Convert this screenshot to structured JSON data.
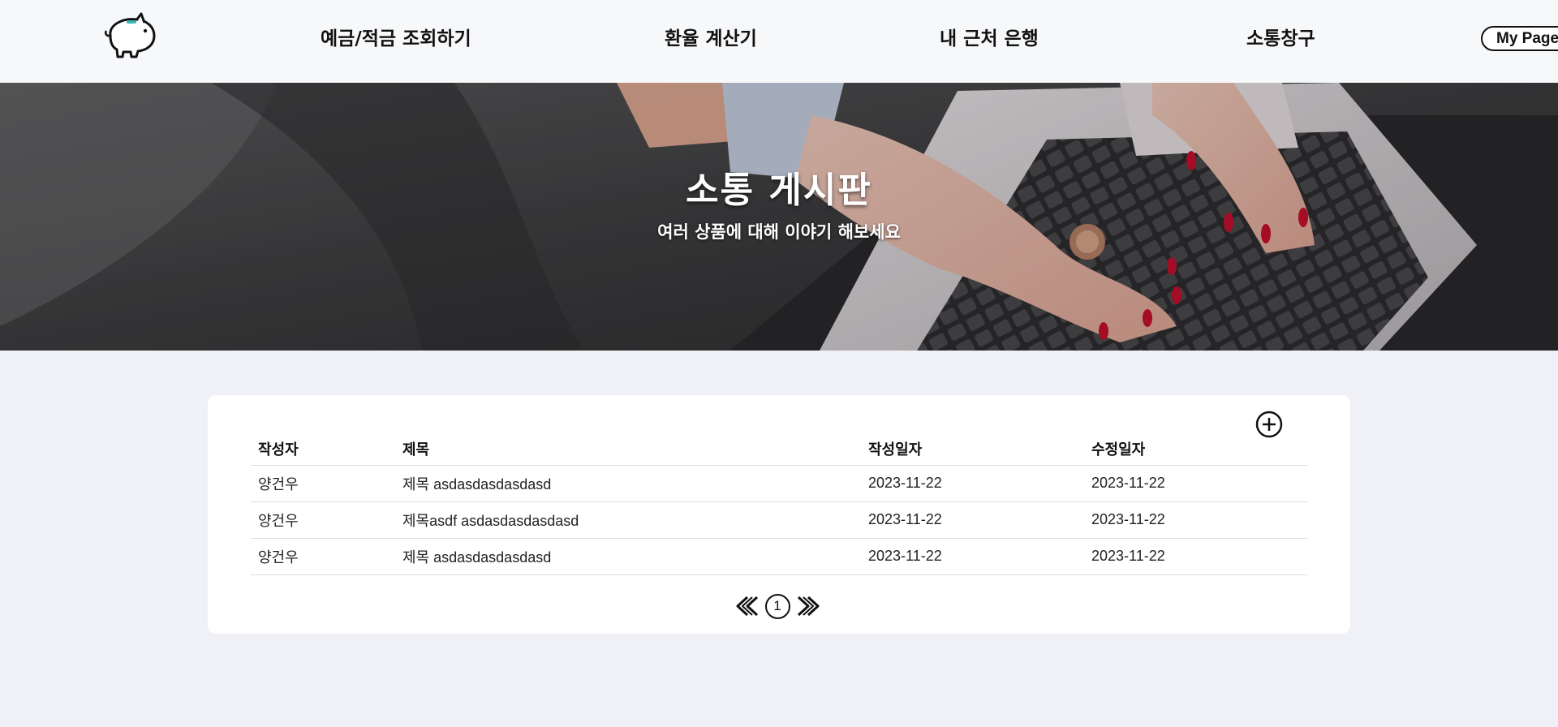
{
  "nav": {
    "logo_icon": "piggy-bank-icon",
    "links": [
      "예금/적금 조회하기",
      "환율 계산기",
      "내 근처 은행",
      "소통창구"
    ],
    "mypage_label": "My Page"
  },
  "hero": {
    "title": "소통 게시판",
    "subtitle": "여러 상품에 대해 이야기 해보세요"
  },
  "board": {
    "add_icon": "plus-circle-icon",
    "columns": [
      "작성자",
      "제목",
      "작성일자",
      "수정일자"
    ],
    "rows": [
      [
        "양건우",
        "제목 asdasdasdasdasd",
        "2023-11-22",
        "2023-11-22"
      ],
      [
        "양건우",
        "제목asdf asdasdasdasdasd",
        "2023-11-22",
        "2023-11-22"
      ],
      [
        "양건우",
        "제목 asdasdasdasdasd",
        "2023-11-22",
        "2023-11-22"
      ]
    ],
    "pagination": {
      "prev_icon": "double-chevron-left-icon",
      "next_icon": "double-chevron-right-icon",
      "current_page": "1"
    }
  },
  "colors": {
    "page_bg": "#f0f1f6",
    "nav_bg": "#f7f8fa",
    "card_bg": "#ffffff",
    "text": "#111111"
  }
}
